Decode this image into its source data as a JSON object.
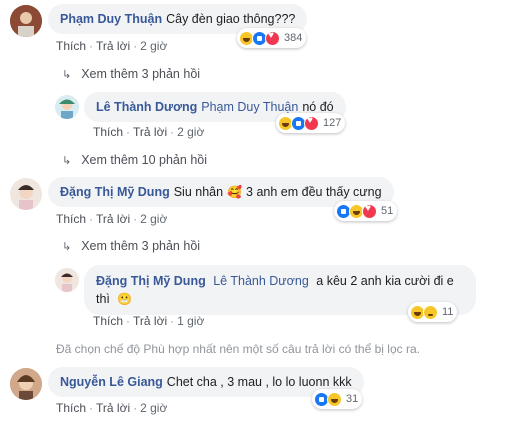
{
  "actions": {
    "like": "Thích",
    "reply": "Trả lời",
    "separator": "·"
  },
  "comments": [
    {
      "author": "Phạm Duy Thuận",
      "text": "Cây đèn giao thông???",
      "time": "2 giờ",
      "reactions": {
        "icons": [
          "haha-icon",
          "like-icon",
          "love-icon"
        ],
        "count": "384"
      },
      "more_replies": "Xem thêm 3 phản hồi"
    },
    {
      "author": "Lê Thành Dương",
      "mention": "Phạm Duy Thuận",
      "text": "nó đó",
      "time": "2 giờ",
      "reactions": {
        "icons": [
          "haha-icon",
          "like-icon",
          "love-icon"
        ],
        "count": "127"
      },
      "more_replies": "Xem thêm 10 phản hồi"
    },
    {
      "author": "Đặng Thị Mỹ Dung",
      "text_before": "Siu nhân",
      "text_after": "3 anh em đều thấy cưng",
      "time": "2 giờ",
      "reactions": {
        "icons": [
          "like-icon",
          "haha-icon",
          "love-icon"
        ],
        "count": "51"
      },
      "more_replies": "Xem thêm 3 phản hồi"
    },
    {
      "author": "Đặng Thị Mỹ Dung",
      "mention": "Lê Thành Dương",
      "text_line1": "a kêu 2 anh kia cười đi e",
      "text_line2": "thì",
      "time": "1 giờ",
      "reactions": {
        "icons": [
          "haha-icon",
          "sad-icon"
        ],
        "count": "11"
      }
    },
    {
      "author": "Nguyễn Lê Giang",
      "text": "Chet cha , 3 mau , lo lo luonn kkk",
      "time": "2 giờ",
      "reactions": {
        "icons": [
          "like-icon",
          "haha-icon"
        ],
        "count": "31"
      }
    }
  ],
  "filter_notice": "Đã chọn chế độ Phù hợp nhất nên một số câu trả lời có thể bị lọc ra.",
  "colors": {
    "link": "#385898",
    "bubble": "#f2f3f5",
    "meta": "#606770"
  }
}
